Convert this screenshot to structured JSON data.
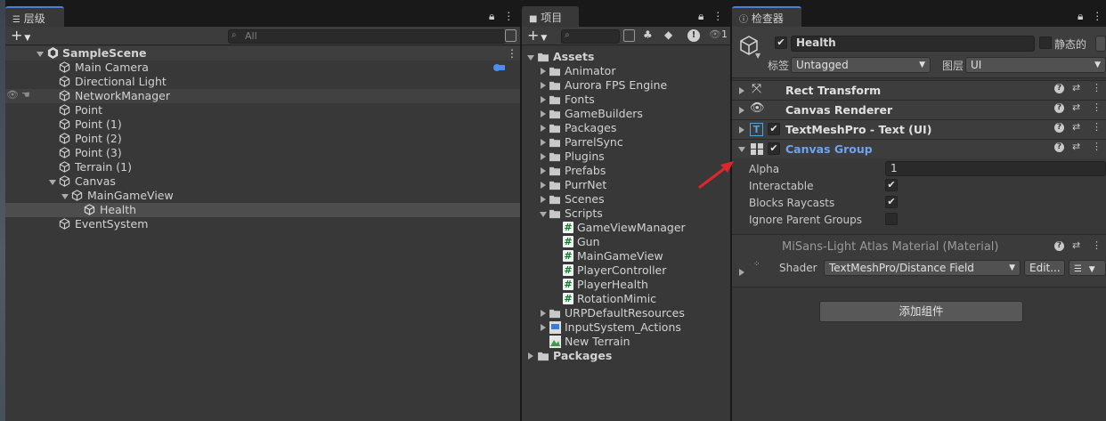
{
  "hierarchy": {
    "tab_label": "层级",
    "search_placeholder": "All",
    "scene": "SampleScene",
    "items": [
      {
        "label": "Main Camera"
      },
      {
        "label": "Directional Light"
      },
      {
        "label": "NetworkManager"
      },
      {
        "label": "Point"
      },
      {
        "label": "Point (1)"
      },
      {
        "label": "Point (2)"
      },
      {
        "label": "Point (3)"
      },
      {
        "label": "Terrain (1)"
      },
      {
        "label": "Canvas"
      },
      {
        "label": "MainGameView"
      },
      {
        "label": "Health"
      },
      {
        "label": "EventSystem"
      }
    ]
  },
  "project": {
    "tab_label": "项目",
    "toolbar_count": "1",
    "tree": [
      {
        "label": "Assets"
      },
      {
        "label": "Animator"
      },
      {
        "label": "Aurora FPS Engine"
      },
      {
        "label": "Fonts"
      },
      {
        "label": "GameBuilders"
      },
      {
        "label": "Packages"
      },
      {
        "label": "ParrelSync"
      },
      {
        "label": "Plugins"
      },
      {
        "label": "Prefabs"
      },
      {
        "label": "PurrNet"
      },
      {
        "label": "Scenes"
      },
      {
        "label": "Scripts"
      },
      {
        "label": "GameViewManager"
      },
      {
        "label": "Gun"
      },
      {
        "label": "MainGameView"
      },
      {
        "label": "PlayerController"
      },
      {
        "label": "PlayerHealth"
      },
      {
        "label": "RotationMimic"
      },
      {
        "label": "URPDefaultResources"
      },
      {
        "label": "InputSystem_Actions"
      },
      {
        "label": "New Terrain"
      },
      {
        "label": "Packages"
      }
    ]
  },
  "inspector": {
    "tab_label": "检查器",
    "object_name": "Health",
    "static_label": "静态的",
    "tag_label": "标签",
    "tag_value": "Untagged",
    "layer_label": "图层",
    "layer_value": "UI",
    "components": [
      {
        "title": "Rect Transform",
        "icon": "rect-transform-icon"
      },
      {
        "title": "Canvas Renderer",
        "icon": "eye-icon"
      },
      {
        "title": "TextMeshPro - Text (UI)",
        "icon": "text-icon"
      },
      {
        "title": "Canvas Group",
        "icon": "canvas-group-icon"
      }
    ],
    "canvas_group": {
      "alpha_label": "Alpha",
      "alpha_value": "1",
      "interactable_label": "Interactable",
      "blocks_raycasts_label": "Blocks Raycasts",
      "ignore_parent_label": "Ignore Parent Groups"
    },
    "material": {
      "title": "MiSans-Light Atlas Material (Material)",
      "shader_label": "Shader",
      "shader_value": "TextMeshPro/Distance Field",
      "edit_label": "Edit..."
    },
    "add_component_label": "添加组件"
  },
  "colors": {
    "selection": "#4d4d4d",
    "accent_blue": "#4c7fd9",
    "arrow_red": "#e0262c",
    "canvas_group_title": "#6fa3ee"
  }
}
